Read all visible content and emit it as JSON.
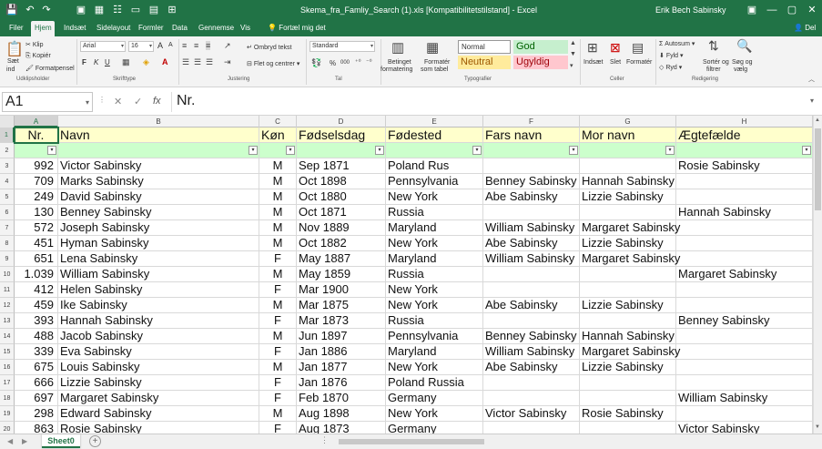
{
  "titlebar": {
    "doc_title": "Skema_fra_Famliy_Search (1).xls  [Kompatibilitetstilstand]  -  Excel",
    "user_name": "Erik Bech Sabinsky",
    "save_icon": "💾",
    "undo_icon": "↶",
    "redo_icon": "↷",
    "quick_icons": [
      "▣",
      "▦",
      "☷",
      "▭",
      "▤",
      "⊞"
    ],
    "minimize": "—",
    "restore": "▢",
    "close": "✕",
    "ribbon_opts": "▣"
  },
  "tabs": [
    "Filer",
    "Hjem",
    "Indsæt",
    "Sidelayout",
    "Formler",
    "Data",
    "Gennemse",
    "Vis"
  ],
  "tellme": "Fortæl mig det",
  "share": "Del",
  "ribbon": {
    "clipboard": {
      "paste": "Sæt",
      "paste2": "ind",
      "cut": "Klip",
      "copy": "Kopiér",
      "format_painter": "Formatpensel",
      "label": "Udklipsholder"
    },
    "font": {
      "name": "Arial",
      "size": "16",
      "bold": "F",
      "italic": "K",
      "underline": "U",
      "grow": "A",
      "shrink": "A",
      "label": "Skrifttype"
    },
    "alignment": {
      "wrap": "Ombryd tekst",
      "merge": "Flet og centrer",
      "label": "Justering"
    },
    "number": {
      "format": "Standard",
      "percent": "%",
      "thousands": "000",
      "label": "Tal"
    },
    "styles": {
      "cond": "Betinget",
      "cond2": "formatering",
      "table": "Formatér",
      "table2": "som tabel",
      "normal": "Normal",
      "good": "God",
      "neutral": "Neutral",
      "bad": "Ugyldig",
      "label": "Typografier"
    },
    "cells": {
      "insert": "Indsæt",
      "delete": "Slet",
      "format": "Formatér",
      "label": "Celler"
    },
    "editing": {
      "autosum": "Autosum",
      "fill": "Fyld",
      "clear": "Ryd",
      "sort": "Sortér og",
      "sort2": "filtrer",
      "find": "Søg og",
      "find2": "vælg",
      "label": "Redigering"
    }
  },
  "formula_bar": {
    "cell_ref": "A1",
    "value": "Nr.",
    "cancel": "✕",
    "enter": "✓",
    "fx": "fx"
  },
  "columns": [
    "A",
    "B",
    "C",
    "D",
    "E",
    "F",
    "G",
    "H"
  ],
  "headers": [
    "Nr.",
    "Navn",
    "Køn",
    "Fødselsdag",
    "Fødested",
    "Fars navn",
    "Mor navn",
    "Ægtefælde"
  ],
  "rows": [
    {
      "n": "3",
      "c": [
        "992",
        "Victor Sabinsky",
        "M",
        "Sep 1871",
        "Poland Rus",
        "",
        "",
        "Rosie Sabinsky"
      ]
    },
    {
      "n": "4",
      "c": [
        "709",
        "Marks Sabinsky",
        "M",
        "Oct 1898",
        "Pennsylvania",
        "Benney Sabinsky",
        "Hannah Sabinsky",
        ""
      ]
    },
    {
      "n": "5",
      "c": [
        "249",
        "David Sabinsky",
        "M",
        "Oct 1880",
        "New York",
        "Abe Sabinsky",
        "Lizzie Sabinsky",
        ""
      ]
    },
    {
      "n": "6",
      "c": [
        "130",
        "Benney Sabinsky",
        "M",
        "Oct 1871",
        "Russia",
        "",
        "",
        "Hannah Sabinsky"
      ]
    },
    {
      "n": "7",
      "c": [
        "572",
        "Joseph Sabinsky",
        "M",
        "Nov 1889",
        "Maryland",
        "William Sabinsky",
        "Margaret Sabinsky",
        ""
      ]
    },
    {
      "n": "8",
      "c": [
        "451",
        "Hyman Sabinsky",
        "M",
        "Oct 1882",
        "New York",
        "Abe Sabinsky",
        "Lizzie Sabinsky",
        ""
      ]
    },
    {
      "n": "9",
      "c": [
        "651",
        "Lena Sabinsky",
        "F",
        "May 1887",
        "Maryland",
        "William Sabinsky",
        "Margaret Sabinsky",
        ""
      ]
    },
    {
      "n": "10",
      "c": [
        "1.039",
        "William Sabinsky",
        "M",
        "May 1859",
        "Russia",
        "",
        "",
        "Margaret Sabinsky"
      ]
    },
    {
      "n": "11",
      "c": [
        "412",
        "Helen Sabinsky",
        "F",
        "Mar 1900",
        "New York",
        "",
        "",
        ""
      ]
    },
    {
      "n": "12",
      "c": [
        "459",
        "Ike Sabinsky",
        "M",
        "Mar 1875",
        "New York",
        "Abe Sabinsky",
        "Lizzie Sabinsky",
        ""
      ]
    },
    {
      "n": "13",
      "c": [
        "393",
        "Hannah Sabinsky",
        "F",
        "Mar 1873",
        "Russia",
        "",
        "",
        "Benney Sabinsky"
      ]
    },
    {
      "n": "14",
      "c": [
        "488",
        "Jacob Sabinsky",
        "M",
        "Jun 1897",
        "Pennsylvania",
        "Benney Sabinsky",
        "Hannah Sabinsky",
        ""
      ]
    },
    {
      "n": "15",
      "c": [
        "339",
        "Eva Sabinsky",
        "F",
        "Jan 1886",
        "Maryland",
        "William Sabinsky",
        "Margaret Sabinsky",
        ""
      ]
    },
    {
      "n": "16",
      "c": [
        "675",
        "Louis Sabinsky",
        "M",
        "Jan 1877",
        "New York",
        "Abe Sabinsky",
        "Lizzie Sabinsky",
        ""
      ]
    },
    {
      "n": "17",
      "c": [
        "666",
        "Lizzie Sabinsky",
        "F",
        "Jan 1876",
        "Poland Russia",
        "",
        "",
        ""
      ]
    },
    {
      "n": "18",
      "c": [
        "697",
        "Margaret Sabinsky",
        "F",
        "Feb 1870",
        "Germany",
        "",
        "",
        "William Sabinsky"
      ]
    },
    {
      "n": "19",
      "c": [
        "298",
        "Edward Sabinsky",
        "M",
        "Aug 1898",
        "New York",
        "Victor Sabinsky",
        "Rosie Sabinsky",
        ""
      ]
    },
    {
      "n": "20",
      "c": [
        "863",
        "Rosie Sabinsky",
        "F",
        "Aug 1873",
        "Germany",
        "",
        "",
        "Victor Sabinsky"
      ]
    }
  ],
  "sheet": {
    "name": "Sheet0",
    "add": "+",
    "prev": "◀",
    "next": "▶"
  },
  "colors": {
    "accent": "#217346",
    "header_fill": "#ffffcc",
    "filter_fill": "#ccffcc"
  }
}
